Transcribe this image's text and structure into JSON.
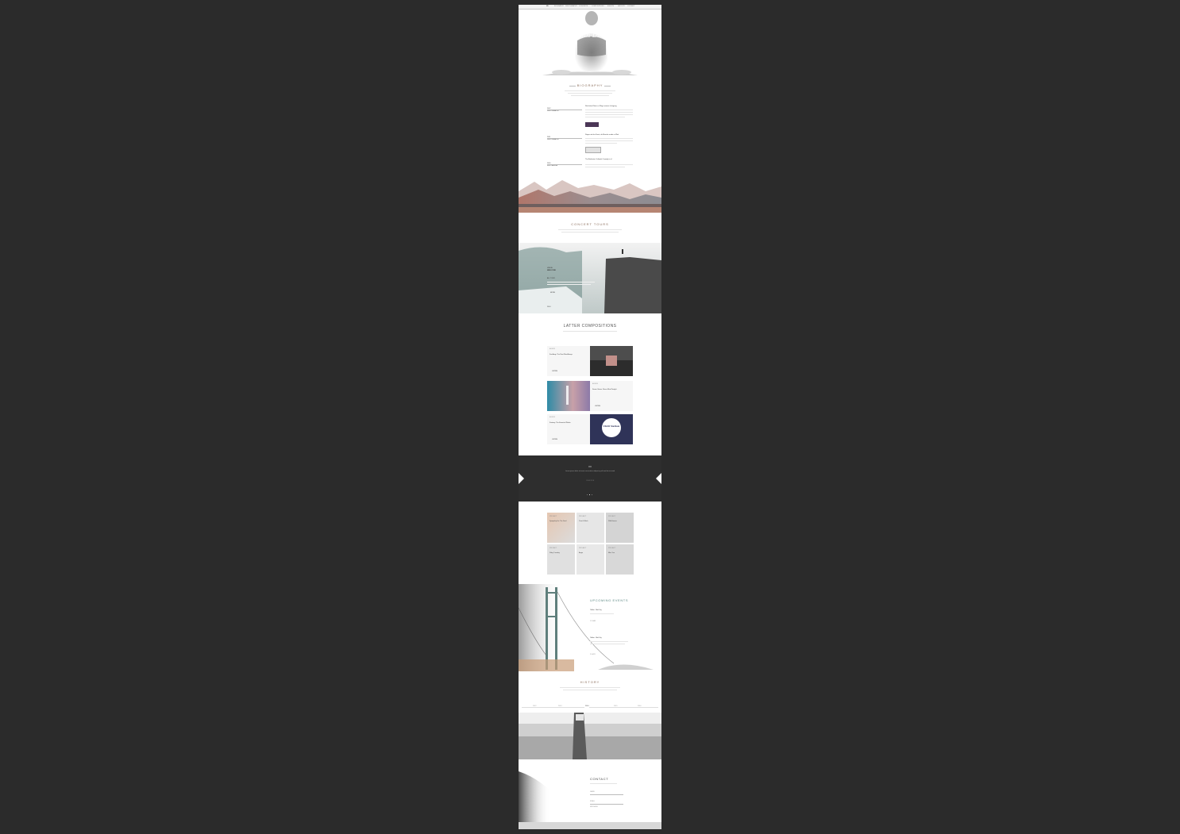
{
  "nav": {
    "logo": "JD",
    "items": [
      "BIOGRAPHY",
      "DISCOGRAPHY",
      "CONCERTS",
      "COMPOSITIONS",
      "EVENTS",
      "HISTORY",
      "CONTACT"
    ]
  },
  "hero": {
    "name": "John Doe"
  },
  "biography": {
    "title": "BIOGRAPHY",
    "entries": [
      {
        "year": "2012",
        "label": "DISCOGRAPHY",
        "headline": "Nicht dem Rhein zu Weg unserem Lehrgang"
      },
      {
        "year": "2011",
        "label": "DISCOGRAPHY",
        "headline": "Regen mit der Kunst, da Manche wurde er Weit"
      },
      {
        "year": "2010",
        "label": "FIRST ALBUM",
        "headline": "The Barbarian Outlands Comedy is of"
      }
    ],
    "more_button": "MORE"
  },
  "concerts": {
    "title": "CONCERT TOURS",
    "venue_label": "VENUE",
    "venue": "NEW YORK",
    "tour_label": "ALL TOUR",
    "date": "2014",
    "button": "MORE"
  },
  "compositions": {
    "title": "LATTER COMPOSITIONS",
    "cards": [
      {
        "tag": "ALBUM",
        "title": "Far Away: The Rest Was Always",
        "button": "LISTEN"
      },
      {
        "tag": "ALBUM",
        "title": "Seven Voices: Never Mind Tonight",
        "button": "LISTEN"
      },
      {
        "tag": "ALBUM",
        "title": "Fantasy: The Essential Works",
        "button": "LISTEN"
      }
    ],
    "cover_text": "Chill Nation"
  },
  "testimonial": {
    "quote": "Lorem ipsum dolor sit amet consectetur adipiscing elit sed do eiusmod",
    "author": "JOHN DOE"
  },
  "tiles": [
    {
      "cat": "PROJECT",
      "title": "Sympathy For The Devil"
    },
    {
      "cat": "PROJECT",
      "title": "Paint It Black"
    },
    {
      "cat": "PROJECT",
      "title": "Wild Horses"
    },
    {
      "cat": "PROJECT",
      "title": "Ruby Tuesday"
    },
    {
      "cat": "PROJECT",
      "title": "Angie"
    },
    {
      "cat": "PROJECT",
      "title": "Miss You"
    }
  ],
  "events": {
    "title": "UPCOMING EVENTS",
    "items": [
      {
        "title": "Tallinn - Mid City",
        "date": "15 MAR"
      },
      {
        "title": "Tallinn - Mid City",
        "date": "22 APR"
      }
    ]
  },
  "history": {
    "title": "HISTORY",
    "years": [
      "2012",
      "2013",
      "2014",
      "2015",
      "2016"
    ],
    "active_year": "2014"
  },
  "contact": {
    "title": "CONTACT",
    "fields": [
      "NAME",
      "EMAIL",
      "MESSAGE"
    ]
  },
  "colors": {
    "backdrop": "#2b2b2b",
    "accent": "#8a6c5a",
    "dark_band": "#2e2e2e"
  }
}
